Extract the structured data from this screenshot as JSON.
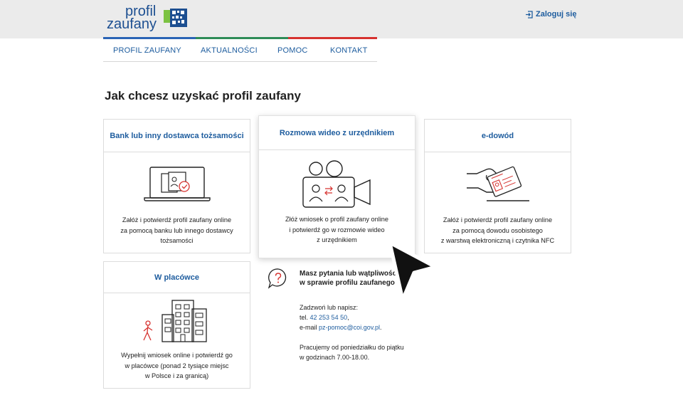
{
  "header": {
    "logo": {
      "line1": "profil",
      "line2": "zaufany"
    },
    "login_label": "Zaloguj się",
    "colors": {
      "brand": "#1d4f91",
      "link": "#1d5c9e",
      "stripe_blue": "#2a63b5",
      "stripe_green": "#2e8b57",
      "stripe_red": "#d6322f"
    }
  },
  "nav": {
    "items": [
      {
        "label": "PROFIL ZAUFANY"
      },
      {
        "label": "AKTUALNOŚCI"
      },
      {
        "label": "POMOC"
      },
      {
        "label": "KONTAKT"
      }
    ]
  },
  "main": {
    "title": "Jak chcesz uzyskać profil zaufany",
    "options": [
      {
        "title": "Bank lub inny dostawca tożsamości",
        "lines": [
          "Załóż i potwierdź profil zaufany online",
          "za pomocą banku lub innego dostawcy",
          "tożsamości"
        ],
        "icon": "laptop-verify-icon"
      },
      {
        "title": "Rozmowa wideo z urzędnikiem",
        "lines": [
          "Złóż wniosek o profil zaufany online",
          "i potwierdź go w rozmowie wideo",
          "z urzędnikiem"
        ],
        "icon": "video-camera-icon"
      },
      {
        "title": "e-dowód",
        "lines": [
          "Załóż i potwierdź profil zaufany online",
          "za pomocą dowodu osobistego",
          "z warstwą elektroniczną i czytnika NFC"
        ],
        "icon": "id-card-icon"
      },
      {
        "title": "W placówce",
        "lines": [
          "Wypełnij wniosek online i potwierdź go",
          "w placówce (ponad 2 tysiące miejsc",
          "w Polsce i za granicą)"
        ],
        "icon": "building-icon"
      }
    ]
  },
  "help": {
    "title_lines": [
      "Masz pytania lub wątpliwości",
      "w sprawie profilu zaufanego"
    ],
    "contact_intro": "Zadzwoń lub napisz:",
    "phone_label": "tel.",
    "phone": "42 253 54 50",
    "phone_suffix": ",",
    "email_label": "e-mail",
    "email": "pz-pomoc@coi.gov.pl",
    "email_suffix": ".",
    "hours_lines": [
      "Pracujemy od poniedziałku do piątku",
      "w godzinach 7.00-18.00."
    ],
    "icon": "question-bubble-icon"
  }
}
